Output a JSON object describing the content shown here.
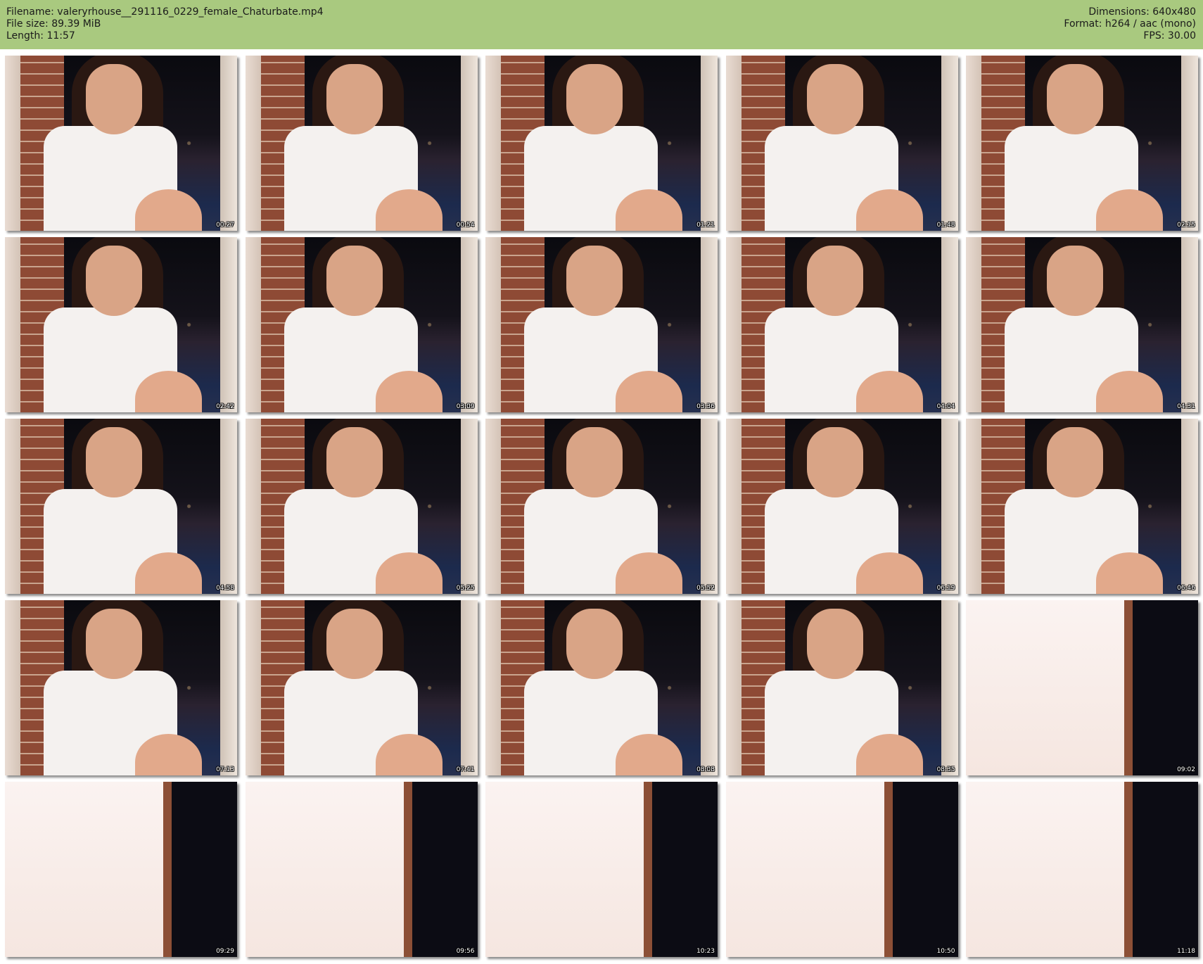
{
  "header": {
    "filename": "Filename: valeryrhouse__291116_0229_female_Chaturbate.mp4",
    "filesize": "File size: 89.39 MiB",
    "length": "Length: 11:57",
    "dimensions": "Dimensions: 640x480",
    "format": "Format: h264 / aac (mono)",
    "fps": "FPS: 30.00",
    "background_color": "#a9c97f"
  },
  "thumbnails": [
    {
      "time": "00:27",
      "scene": "night"
    },
    {
      "time": "00:54",
      "scene": "night"
    },
    {
      "time": "01:21",
      "scene": "night"
    },
    {
      "time": "01:48",
      "scene": "night"
    },
    {
      "time": "02:15",
      "scene": "night"
    },
    {
      "time": "02:42",
      "scene": "night"
    },
    {
      "time": "03:09",
      "scene": "night"
    },
    {
      "time": "03:36",
      "scene": "night"
    },
    {
      "time": "04:04",
      "scene": "night"
    },
    {
      "time": "04:31",
      "scene": "night"
    },
    {
      "time": "04:58",
      "scene": "night"
    },
    {
      "time": "05:25",
      "scene": "night"
    },
    {
      "time": "05:52",
      "scene": "night"
    },
    {
      "time": "06:19",
      "scene": "night"
    },
    {
      "time": "06:46",
      "scene": "night"
    },
    {
      "time": "07:13",
      "scene": "night"
    },
    {
      "time": "07:41",
      "scene": "night"
    },
    {
      "time": "08:08",
      "scene": "night"
    },
    {
      "time": "08:35",
      "scene": "night"
    },
    {
      "time": "09:02",
      "scene": "bright"
    },
    {
      "time": "09:29",
      "scene": "bright"
    },
    {
      "time": "09:56",
      "scene": "bright"
    },
    {
      "time": "10:23",
      "scene": "bright"
    },
    {
      "time": "10:50",
      "scene": "bright"
    },
    {
      "time": "11:18",
      "scene": "bright"
    }
  ]
}
